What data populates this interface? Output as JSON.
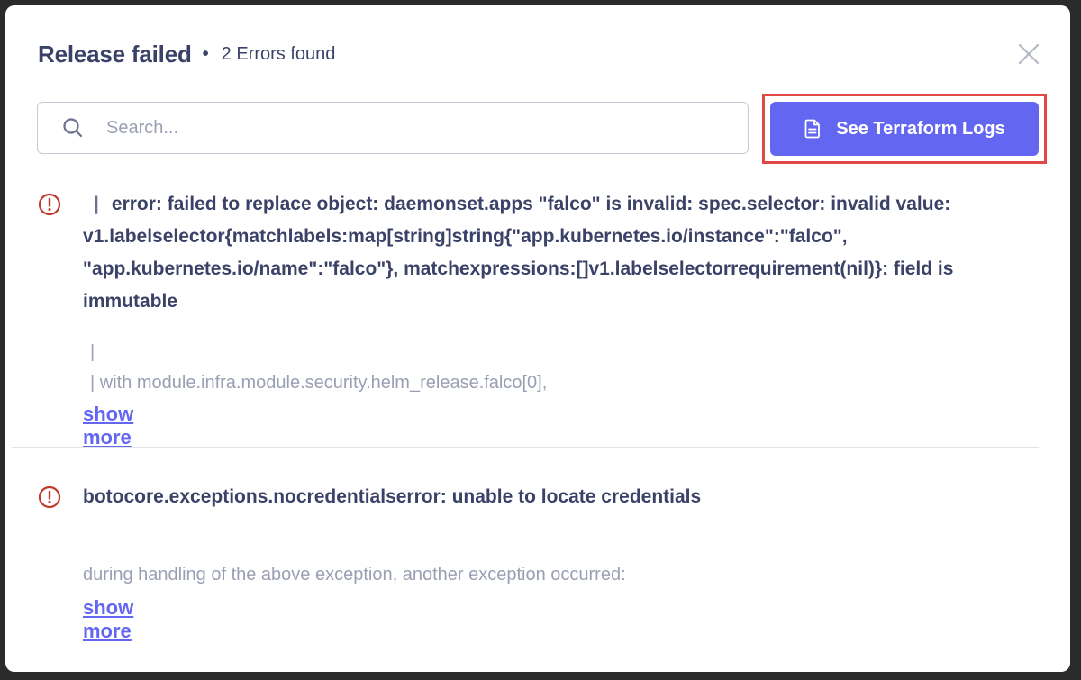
{
  "header": {
    "title": "Release failed",
    "separator": "•",
    "subtitle": "2 Errors found"
  },
  "search": {
    "placeholder": "Search...",
    "value": ""
  },
  "actions": {
    "terraform_logs_label": "See Terraform Logs"
  },
  "errors": [
    {
      "prefix": "|",
      "message": "error: failed to replace object: daemonset.apps \"falco\" is invalid: spec.selector: invalid value: v1.labelselector{matchlabels:map[string]string{\"app.kubernetes.io/instance\":\"falco\", \"app.kubernetes.io/name\":\"falco\"}, matchexpressions:[]v1.labelselectorrequirement(nil)}: field is immutable",
      "detail_line_1": "|",
      "detail_line_2": "|  with module.infra.module.security.helm_release.falco[0],",
      "show_more": "show more"
    },
    {
      "message": "botocore.exceptions.nocredentialserror: unable to locate credentials",
      "detail_line_1": "during handling of the above exception, another exception occurred:",
      "show_more": "show more"
    }
  ],
  "colors": {
    "title": "#3b4268",
    "accent": "#6366f1",
    "error": "#c0392b",
    "muted": "#9a9fb3",
    "highlight": "#e04848"
  }
}
